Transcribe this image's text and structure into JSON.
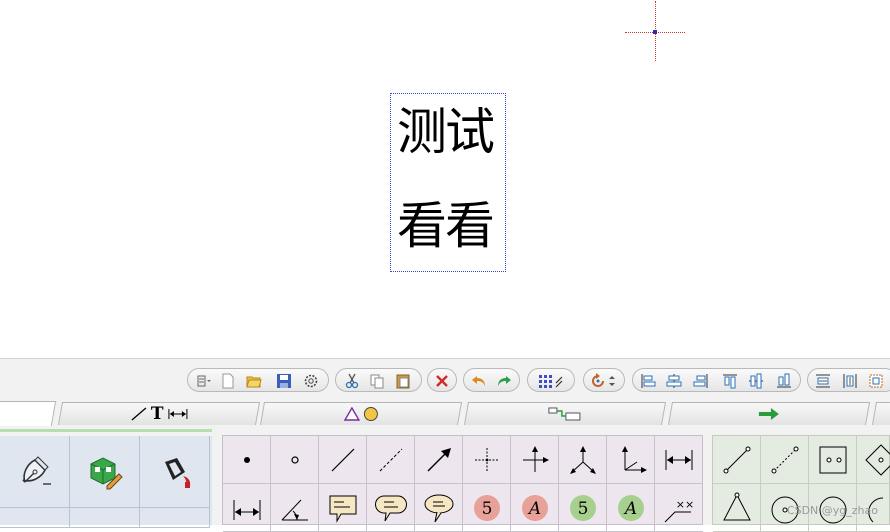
{
  "canvas": {
    "text_lines": [
      "测试",
      "看看"
    ]
  },
  "toolbar": {
    "groups": [
      [
        "view-menu-icon",
        "new-icon",
        "open-icon",
        "save-icon",
        "settings-icon"
      ],
      [
        "cut-icon",
        "copy-icon",
        "paste-icon"
      ],
      [
        "delete-icon"
      ],
      [
        "undo-icon",
        "redo-icon"
      ],
      [
        "grid-snap-icon"
      ],
      [
        "rotate-icon"
      ],
      [
        "align-left-icon",
        "align-center-icon",
        "align-right-icon",
        "align-top-icon",
        "align-middle-icon",
        "align-bottom-icon"
      ],
      [
        "distribute-h-icon",
        "distribute-v-icon",
        "size-icon"
      ]
    ]
  },
  "tabs": [
    {
      "name": "tab-draw",
      "text": ""
    },
    {
      "name": "tab-line-text-dimension",
      "text": "T"
    },
    {
      "name": "tab-shapes",
      "text": ""
    },
    {
      "name": "tab-connectors",
      "text": ""
    },
    {
      "name": "tab-arrows",
      "text": ""
    }
  ],
  "palette_mid": {
    "badge_labels": [
      "5",
      "A",
      "5",
      "A"
    ],
    "arc_label": "××"
  },
  "watermark": "CSDN @yg_zhao",
  "colors": {
    "accent_green": "#2a9d3a",
    "badge_red": "#e8a198",
    "badge_green": "#a7cf8e",
    "selection_blue": "#3344cc"
  }
}
